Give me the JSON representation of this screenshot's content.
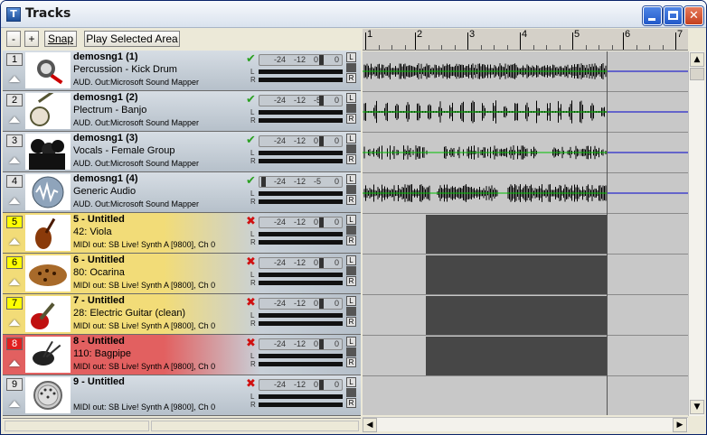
{
  "window": {
    "title": "Tracks",
    "app_icon_glyph": "T",
    "minimize_glyph": "",
    "maximize_glyph": "",
    "close_glyph": "✕"
  },
  "toolbar": {
    "minus_label": "-",
    "plus_label": "+",
    "snap_label": "Snap",
    "play_label": "Play Selected Area"
  },
  "ruler": {
    "marks": [
      "1",
      "2",
      "3",
      "4",
      "5",
      "6",
      "7"
    ]
  },
  "meter": {
    "db1": "-24",
    "db2": "-12",
    "db_zero": "0",
    "left": "L",
    "right": "R"
  },
  "tracks": [
    {
      "number": "1",
      "name": "demosng1 (1)",
      "instrument": "Percussion - Kick Drum",
      "output": "AUD. Out:Microsoft Sound Mapper",
      "kind": "audio",
      "enabled": true,
      "icon": "microphone-icon",
      "mid": "0"
    },
    {
      "number": "2",
      "name": "demosng1 (2)",
      "instrument": "Plectrum - Banjo",
      "output": "AUD. Out:Microsoft Sound Mapper",
      "kind": "audio",
      "enabled": true,
      "icon": "banjo-icon",
      "mid": "-5"
    },
    {
      "number": "3",
      "name": "demosng1 (3)",
      "instrument": "Vocals - Female Group",
      "output": "AUD. Out:Microsoft Sound Mapper",
      "kind": "audio",
      "enabled": true,
      "icon": "singers-icon",
      "mid": "0"
    },
    {
      "number": "4",
      "name": "demosng1 (4)",
      "instrument": "Generic Audio",
      "output": "AUD. Out:Microsoft Sound Mapper",
      "kind": "audio",
      "enabled": true,
      "icon": "audio-wave-icon",
      "mid": "-5"
    },
    {
      "number": "5",
      "name": "5 - Untitled",
      "instrument": "42: Viola",
      "output": "MIDI out: SB Live! Synth A [9800], Ch 0",
      "kind": "midi",
      "enabled": false,
      "icon": "violin-icon",
      "mid": "0"
    },
    {
      "number": "6",
      "name": "6 - Untitled",
      "instrument": "80: Ocarina",
      "output": "MIDI out: SB Live! Synth A [9800], Ch 0",
      "kind": "midi",
      "enabled": false,
      "icon": "ocarina-icon",
      "mid": "0"
    },
    {
      "number": "7",
      "name": "7 - Untitled",
      "instrument": "28: Electric Guitar (clean)",
      "output": "MIDI out: SB Live! Synth A [9800], Ch 0",
      "kind": "midi",
      "enabled": false,
      "icon": "electric-guitar-icon",
      "mid": "0"
    },
    {
      "number": "8",
      "name": "8 - Untitled",
      "instrument": "110: Bagpipe",
      "output": "MIDI out: SB Live! Synth A [9800], Ch 0",
      "kind": "midi",
      "enabled": false,
      "icon": "bagpipe-icon",
      "mid": "0"
    },
    {
      "number": "9",
      "name": "9 - Untitled",
      "instrument": "",
      "output": "MIDI out: SB Live! Synth A [9800], Ch 0",
      "kind": "midi",
      "enabled": false,
      "icon": "midi-plug-icon",
      "mid": "0"
    }
  ],
  "colors": {
    "num_yellow": "#ffff00",
    "num_red": "#e02020",
    "gradient_yellow": "#f2dc78",
    "gradient_red": "#e26060",
    "waveform": "#000000",
    "center_line_green": "#00c000",
    "end_line_blue": "#0000cc"
  },
  "scroll": {
    "up_glyph": "▲",
    "down_glyph": "▼",
    "left_glyph": "◀",
    "right_glyph": "▶"
  }
}
